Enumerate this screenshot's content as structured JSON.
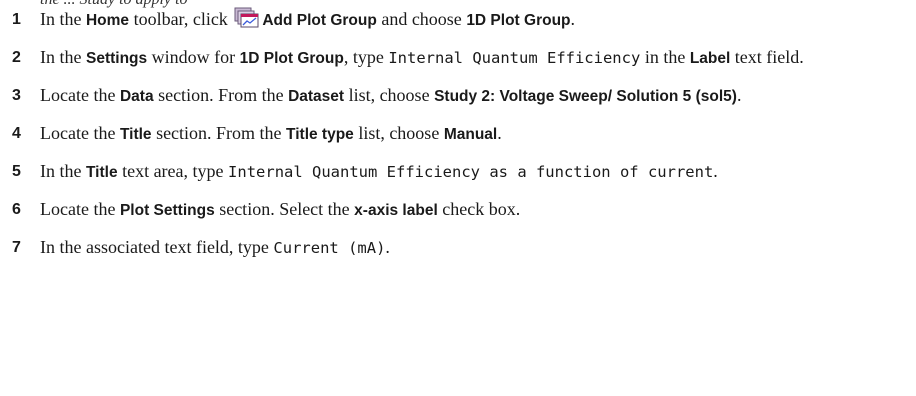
{
  "intro_partial": "the ... Study to apply to",
  "steps": [
    {
      "num": "1",
      "t1": "In the ",
      "b1": "Home",
      "t2": " toolbar, click ",
      "icon": "add-plot-group-icon",
      "b2": "Add Plot Group",
      "t3": " and choose ",
      "b3": "1D Plot Group",
      "t4": "."
    },
    {
      "num": "2",
      "t1": "In the ",
      "b1": "Settings",
      "t2": " window for ",
      "b2": "1D Plot Group",
      "t3": ", type ",
      "c1": "Internal Quantum Efficiency",
      "t4": " in the ",
      "b3": "Label",
      "t5": " text field."
    },
    {
      "num": "3",
      "t1": "Locate the ",
      "b1": "Data",
      "t2": " section. From the ",
      "b2": "Dataset",
      "t3": " list, choose ",
      "b3": "Study 2: Voltage Sweep/ Solution 5 (sol5)",
      "t4": "."
    },
    {
      "num": "4",
      "t1": "Locate the ",
      "b1": "Title",
      "t2": " section. From the ",
      "b2": "Title type",
      "t3": " list, choose ",
      "b3": "Manual",
      "t4": "."
    },
    {
      "num": "5",
      "t1": "In the ",
      "b1": "Title",
      "t2": " text area, type ",
      "c1": "Internal Quantum Efficiency as a function of current",
      "t3": "."
    },
    {
      "num": "6",
      "t1": "Locate the ",
      "b1": "Plot Settings",
      "t2": " section. Select the ",
      "b2": "x-axis label",
      "t3": " check box."
    },
    {
      "num": "7",
      "t1": "In the associated text field, type ",
      "c1": "Current (mA)",
      "t2": "."
    }
  ]
}
